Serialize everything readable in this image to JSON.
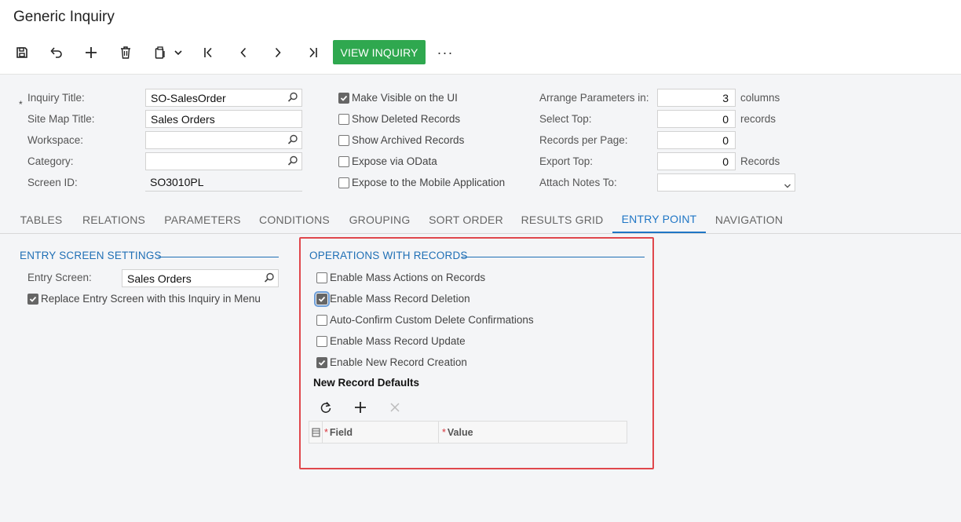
{
  "page": {
    "title": "Generic Inquiry"
  },
  "toolbar": {
    "view_inquiry_label": "VIEW INQUIRY",
    "more_label": "···",
    "icons": [
      "save-icon",
      "undo-icon",
      "add-icon",
      "delete-icon",
      "clipboard-icon",
      "chevron-down-icon",
      "first-record-icon",
      "previous-record-icon",
      "next-record-icon",
      "last-record-icon"
    ]
  },
  "form": {
    "required_mark": "*",
    "inquiry_title_label": "Inquiry Title:",
    "inquiry_title_value": "SO-SalesOrder",
    "site_map_title_label": "Site Map Title:",
    "site_map_title_value": "Sales Orders",
    "workspace_label": "Workspace:",
    "workspace_value": "",
    "category_label": "Category:",
    "category_value": "",
    "screen_id_label": "Screen ID:",
    "screen_id_value": "SO3010PL",
    "options": [
      {
        "label": "Make Visible on the UI",
        "checked": true
      },
      {
        "label": "Show Deleted Records",
        "checked": false
      },
      {
        "label": "Show Archived Records",
        "checked": false
      },
      {
        "label": "Expose via OData",
        "checked": false
      },
      {
        "label": "Expose to the Mobile Application",
        "checked": false
      }
    ],
    "arrange_label": "Arrange Parameters in:",
    "arrange_value": "3",
    "arrange_unit": "columns",
    "select_top_label": "Select Top:",
    "select_top_value": "0",
    "select_top_unit": "records",
    "records_per_page_label": "Records per Page:",
    "records_per_page_value": "0",
    "export_top_label": "Export Top:",
    "export_top_value": "0",
    "export_top_unit": "Records",
    "attach_notes_label": "Attach Notes To:",
    "attach_notes_value": ""
  },
  "tabs": [
    {
      "label": "TABLES",
      "active": false
    },
    {
      "label": "RELATIONS",
      "active": false
    },
    {
      "label": "PARAMETERS",
      "active": false
    },
    {
      "label": "CONDITIONS",
      "active": false
    },
    {
      "label": "GROUPING",
      "active": false
    },
    {
      "label": "SORT ORDER",
      "active": false
    },
    {
      "label": "RESULTS GRID",
      "active": false
    },
    {
      "label": "ENTRY POINT",
      "active": true
    },
    {
      "label": "NAVIGATION",
      "active": false
    }
  ],
  "entry_screen_settings": {
    "title": "ENTRY SCREEN SETTINGS",
    "entry_screen_label": "Entry Screen:",
    "entry_screen_value": "Sales Orders",
    "replace_label": "Replace Entry Screen with this Inquiry in Menu",
    "replace_checked": true
  },
  "operations": {
    "title": "OPERATIONS WITH RECORDS",
    "items": [
      {
        "label": "Enable Mass Actions on Records",
        "checked": false
      },
      {
        "label": "Enable Mass Record Deletion",
        "checked": true
      },
      {
        "label": "Auto-Confirm Custom Delete Confirmations",
        "checked": false
      },
      {
        "label": "Enable Mass Record Update",
        "checked": false
      },
      {
        "label": "Enable New Record Creation",
        "checked": true
      }
    ],
    "defaults_title": "New Record Defaults",
    "grid_columns": [
      "Field",
      "Value"
    ],
    "required_mark": "*"
  },
  "colors": {
    "accent": "#1f76c5",
    "primary_button": "#2fa84f",
    "highlight": "#e0474c"
  }
}
